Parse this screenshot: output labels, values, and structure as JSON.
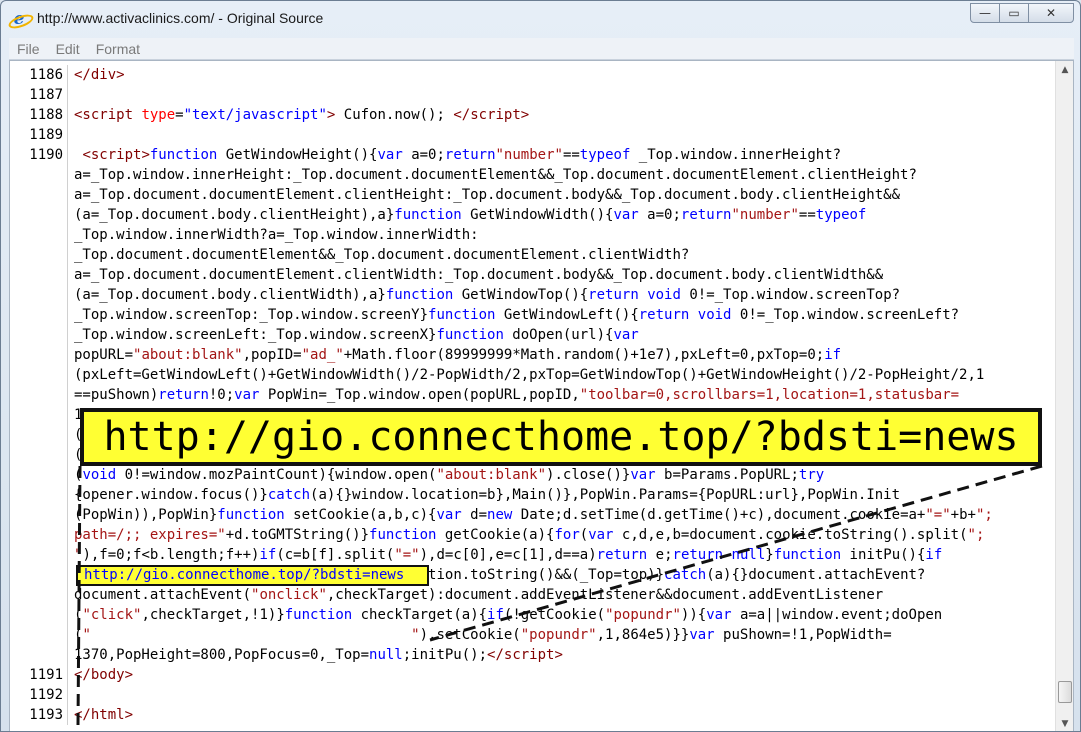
{
  "window": {
    "title": "http://www.activaclinics.com/ - Original Source",
    "min_glyph": "—",
    "max_glyph": "▭",
    "close_glyph": "✕"
  },
  "menu": [
    "File",
    "Edit",
    "Format"
  ],
  "lines": [
    {
      "n": "1186",
      "html": "<span class=\"tag\">&lt;/div&gt;</span>"
    },
    {
      "n": "1187",
      "html": ""
    },
    {
      "n": "1188",
      "html": "<span class=\"tag\">&lt;script</span> <span class=\"attr\">type</span>=<span class=\"str\">\"text/javascript\"</span><span class=\"tag\">&gt;</span> Cufon.now(); <span class=\"tag\">&lt;/script&gt;</span>"
    },
    {
      "n": "1189",
      "html": ""
    },
    {
      "n": "1190",
      "html": " <span class=\"tag\">&lt;script&gt;</span><span class=\"kw\">function</span> GetWindowHeight(){<span class=\"kw\">var</span> a=0;<span class=\"kw\">return</span><span class=\"s\">\"number\"</span>==<span class=\"kw\">typeof</span> _Top.window.innerHeight?"
    },
    {
      "n": "",
      "html": "a=_Top.window.innerHeight:_Top.document.documentElement&amp;&amp;_Top.document.documentElement.clientHeight?"
    },
    {
      "n": "",
      "html": "a=_Top.document.documentElement.clientHeight:_Top.document.body&amp;&amp;_Top.document.body.clientHeight&amp;&amp;"
    },
    {
      "n": "",
      "html": "(a=_Top.document.body.clientHeight),a}<span class=\"kw\">function</span> GetWindowWidth(){<span class=\"kw\">var</span> a=0;<span class=\"kw\">return</span><span class=\"s\">\"number\"</span>==<span class=\"kw\">typeof</span>"
    },
    {
      "n": "",
      "html": "_Top.window.innerWidth?a=_Top.window.innerWidth:"
    },
    {
      "n": "",
      "html": "_Top.document.documentElement&amp;&amp;_Top.document.documentElement.clientWidth?"
    },
    {
      "n": "",
      "html": "a=_Top.document.documentElement.clientWidth:_Top.document.body&amp;&amp;_Top.document.body.clientWidth&amp;&amp;"
    },
    {
      "n": "",
      "html": "(a=_Top.document.body.clientWidth),a}<span class=\"kw\">function</span> GetWindowTop(){<span class=\"kw\">return</span> <span class=\"kw\">void</span> 0!=_Top.window.screenTop?"
    },
    {
      "n": "",
      "html": "_Top.window.screenTop:_Top.window.screenY}<span class=\"kw\">function</span> GetWindowLeft(){<span class=\"kw\">return</span> <span class=\"kw\">void</span> 0!=_Top.window.screenLeft?"
    },
    {
      "n": "",
      "html": "_Top.window.screenLeft:_Top.window.screenX}<span class=\"kw\">function</span> doOpen(url){<span class=\"kw\">var</span>"
    },
    {
      "n": "",
      "html": "popURL=<span class=\"s\">\"about:blank\"</span>,popID=<span class=\"s\">\"ad_\"</span>+Math.floor(89999999*Math.random()+1e7),pxLeft=0,pxTop=0;<span class=\"kw\">if</span>"
    },
    {
      "n": "",
      "html": "(pxLeft=GetWindowLeft()+GetWindowWidth()/2-PopWidth/2,pxTop=GetWindowTop()+GetWindowHeight()/2-PopHeight/2,1"
    },
    {
      "n": "",
      "html": "==puShown)<span class=\"kw\">return</span>!0;<span class=\"kw\">var</span> PopWin=_Top.window.open(popURL,popID,<span class=\"s\">\"toolbar=0,scrollbars=1,location=1,statusbar=</span>"
    },
    {
      "n": "",
      "html": "1"
    },
    {
      "n": "",
      "html": "("
    },
    {
      "n": "",
      "html": "("
    },
    {
      "n": "",
      "html": "(<span class=\"kw\">void</span> 0!=window.mozPaintCount){window.open(<span class=\"s\">\"about:blank\"</span>).close()}<span class=\"kw\">var</span> b=Params.PopURL;<span class=\"kw\">try</span>"
    },
    {
      "n": "",
      "html": "{opener.window.focus()}<span class=\"kw\">catch</span>(a){}window.location=b},Main()},PopWin.Params={PopURL:url},PopWin.Init"
    },
    {
      "n": "",
      "html": "(PopWin)),PopWin}<span class=\"kw\">function</span> setCookie(a,b,c){<span class=\"kw\">var</span> d=<span class=\"kw\">new</span> Date;d.setTime(d.getTime()+c),document.cookie=a+<span class=\"s\">\"=\"</span>+b+<span class=\"s\">\";</span>"
    },
    {
      "n": "",
      "html": "<span class=\"s\">path=/;; expires=\"</span>+d.toGMTString()}<span class=\"kw\">function</span> getCookie(a){<span class=\"kw\">for</span>(<span class=\"kw\">var</span> c,d,e,b=document.cookie.toString().split(<span class=\"s\">\";</span>"
    },
    {
      "n": "",
      "html": "<span class=\"s\">\"</span>),f=0;f&lt;b.length;f++)<span class=\"kw\">if</span>(c=b[f].split(<span class=\"s\">\"=\"</span>),d=c[0],e=c[1],d==a)<span class=\"kw\">return</span> e;<span class=\"kw\">return</span> <span class=\"kw\">null</span>}<span class=\"kw\">function</span> initPu(){<span class=\"kw\">if</span>"
    },
    {
      "n": "",
      "html": "(_Top=self,top!=self)<span class=\"kw\">try</span>{top.document.location.toString()&amp;&amp;(_Top=top)}<span class=\"kw\">catch</span>(a){}document.attachEvent?"
    },
    {
      "n": "",
      "html": "document.attachEvent(<span class=\"s\">\"onclick\"</span>,checkTarget):document.addEventListener&amp;&amp;document.addEventListener"
    },
    {
      "n": "",
      "html": "(<span class=\"s\">\"click\"</span>,checkTarget,!1)}<span class=\"kw\">function</span> checkTarget(a){<span class=\"kw\">if</span>(!getCookie(<span class=\"s\">\"popundr\"</span>)){<span class=\"kw\">var</span> a=a||window.event;doOpen"
    },
    {
      "n": "",
      "html": "(<span class=\"s\">\"                                      \"</span>),setCookie(<span class=\"s\">\"popundr\"</span>,1,864e5)}}<span class=\"kw\">var</span> puShown=!1,PopWidth="
    },
    {
      "n": "",
      "html": "1370,PopHeight=800,PopFocus=0,_Top=<span class=\"kw\">null</span>;initPu();<span class=\"tag\">&lt;/script&gt;</span>"
    },
    {
      "n": "1191",
      "html": "<span class=\"tag\">&lt;/body&gt;</span>"
    },
    {
      "n": "1192",
      "html": ""
    },
    {
      "n": "1193",
      "html": "<span class=\"tag\">&lt;/html&gt;</span>"
    }
  ],
  "highlight": {
    "inline_url": "http://gio.connecthome.top/?bdsti=news",
    "callout_url": "http://gio.connecthome.top/?bdsti=news",
    "color": "#ffff33"
  },
  "scrollbar": {
    "up": "▲",
    "down": "▼"
  }
}
